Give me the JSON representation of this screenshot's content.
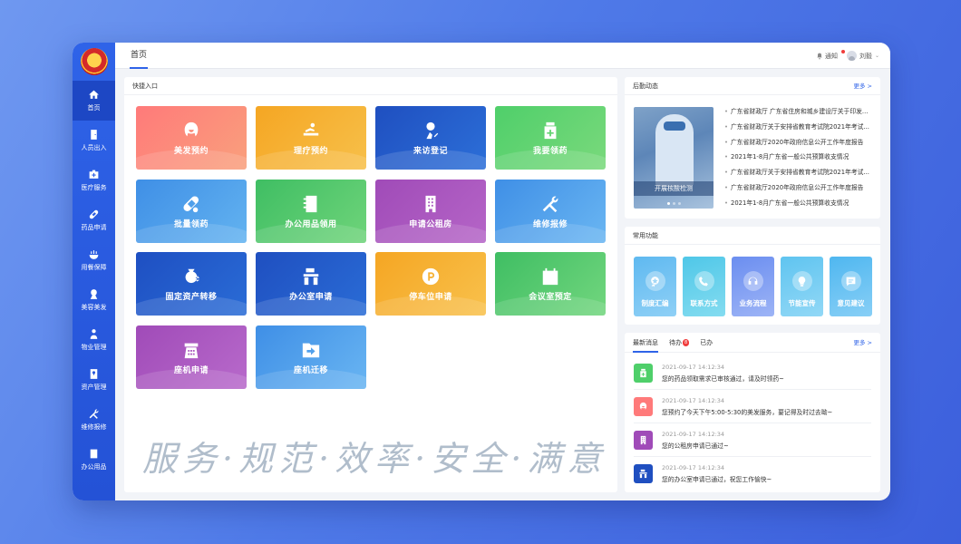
{
  "topbar": {
    "tab": "首页",
    "notify_label": "通知",
    "user_name": "刘毅"
  },
  "sidebar": {
    "items": [
      {
        "label": "首页",
        "icon": "home-icon"
      },
      {
        "label": "人员出入",
        "icon": "door-icon"
      },
      {
        "label": "医疗服务",
        "icon": "medical-kit-icon"
      },
      {
        "label": "药品申请",
        "icon": "pill-icon"
      },
      {
        "label": "用餐保障",
        "icon": "dining-icon"
      },
      {
        "label": "美容美发",
        "icon": "salon-icon"
      },
      {
        "label": "物业管理",
        "icon": "property-icon"
      },
      {
        "label": "资产管理",
        "icon": "asset-icon"
      },
      {
        "label": "维修报修",
        "icon": "tools-icon"
      },
      {
        "label": "办公用品",
        "icon": "office-supplies-icon"
      }
    ]
  },
  "quick": {
    "title": "快捷入口",
    "tiles": [
      {
        "label": "美发预约",
        "icon": "hair-icon",
        "color": [
          "#ff7a7a",
          "#f9a07c"
        ]
      },
      {
        "label": "理疗预约",
        "icon": "massage-icon",
        "color": [
          "#f5a623",
          "#f7c04a"
        ]
      },
      {
        "label": "来访登记",
        "icon": "visitor-icon",
        "color": [
          "#1f4fc0",
          "#2c6fd8"
        ]
      },
      {
        "label": "我要领药",
        "icon": "medicine-icon",
        "color": [
          "#4fcf6a",
          "#7ad97c"
        ]
      },
      {
        "label": "批量领药",
        "icon": "capsule-icon",
        "color": [
          "#3f8fe6",
          "#63b3f0"
        ]
      },
      {
        "label": "办公用品领用",
        "icon": "notebook-icon",
        "color": [
          "#3fbe63",
          "#6fd47a"
        ]
      },
      {
        "label": "申请公租房",
        "icon": "building-icon",
        "color": [
          "#a04bb8",
          "#b565c7"
        ]
      },
      {
        "label": "维修报修",
        "icon": "tools-icon",
        "color": [
          "#3f8fe6",
          "#6ab6f2"
        ]
      },
      {
        "label": "固定资产转移",
        "icon": "asset-transfer-icon",
        "color": [
          "#1e4fc2",
          "#2a6cd6"
        ]
      },
      {
        "label": "办公室申请",
        "icon": "office-desk-icon",
        "color": [
          "#1f4fc0",
          "#2a6cd6"
        ]
      },
      {
        "label": "停车位申请",
        "icon": "parking-icon",
        "color": [
          "#f5a623",
          "#f8c14c"
        ]
      },
      {
        "label": "会议室预定",
        "icon": "calendar-check-icon",
        "color": [
          "#3fbe63",
          "#72d67e"
        ]
      },
      {
        "label": "座机申请",
        "icon": "phone-icon",
        "color": [
          "#a04bb8",
          "#b86acb"
        ]
      },
      {
        "label": "座机迁移",
        "icon": "folder-move-icon",
        "color": [
          "#3f8fe6",
          "#69b5f2"
        ]
      }
    ],
    "slogan": "服务·规范·效率·安全·满意"
  },
  "news": {
    "title": "后勤动态",
    "more": "更多 >",
    "image_caption": "开展核酸检测",
    "items": [
      "广东省财政厅 广东省住房和城乡建设厅关于印发...",
      "广东省财政厅关于安排省教育考试院2021年考试...",
      "广东省财政厅2020年政府信息公开工作年度报告",
      "2021年1-8月广东省一般公共预算收支情况",
      "广东省财政厅关于安排省教育考试院2021年考试...",
      "广东省财政厅2020年政府信息公开工作年度报告",
      "2021年1-8月广东省一般公共预算收支情况"
    ]
  },
  "common": {
    "title": "常用功能",
    "items": [
      {
        "label": "制度汇编",
        "icon": "star-badge-icon",
        "color": [
          "#5fb9f0",
          "#8fd0f6"
        ]
      },
      {
        "label": "联系方式",
        "icon": "phone-call-icon",
        "color": [
          "#4fc7e8",
          "#84dcf0"
        ]
      },
      {
        "label": "业务流程",
        "icon": "headset-icon",
        "color": [
          "#6b8ef0",
          "#9db4f6"
        ]
      },
      {
        "label": "节能宣传",
        "icon": "bulb-icon",
        "color": [
          "#5fc4f0",
          "#92d8f6"
        ]
      },
      {
        "label": "意见建议",
        "icon": "chat-icon",
        "color": [
          "#4fb7f0",
          "#88cff6"
        ]
      }
    ]
  },
  "messages": {
    "tabs": [
      "最新消息",
      "待办",
      "已办"
    ],
    "todo_count": "8",
    "more": "更多 >",
    "items": [
      {
        "time": "2021-09-17 14:12:34",
        "text": "您的药品领取需求已审核通过，请及时领药~",
        "icon": "medicine-icon",
        "color": "#4fcf6a"
      },
      {
        "time": "2021-09-17 14:12:34",
        "text": "您预约了今天下午5:00-5:30的美发服务，要记得及时过去呦~",
        "icon": "hair-icon",
        "color": "#ff7a7a"
      },
      {
        "time": "2021-09-17 14:12:34",
        "text": "您的公租房申请已通过~",
        "icon": "building-icon",
        "color": "#a04bb8"
      },
      {
        "time": "2021-09-17 14:12:34",
        "text": "您的办公室申请已通过，祝您工作愉快~",
        "icon": "office-desk-icon",
        "color": "#1f4fc0"
      }
    ]
  }
}
